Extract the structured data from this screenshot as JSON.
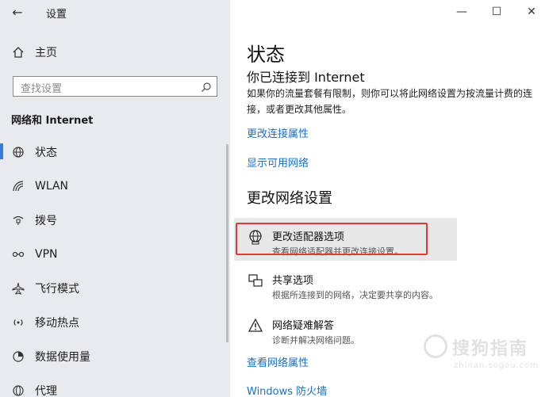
{
  "app": {
    "title": "设置",
    "back_glyph": "←"
  },
  "window": {
    "minimize": "—",
    "maximize": "☐",
    "close": "✕"
  },
  "sidebar": {
    "home_label": "主页",
    "search_placeholder": "查找设置",
    "section_title": "网络和 Internet",
    "items": [
      {
        "label": "状态",
        "icon": "globe-icon",
        "active": true
      },
      {
        "label": "WLAN",
        "icon": "wifi-icon",
        "active": false
      },
      {
        "label": "拨号",
        "icon": "dialup-icon",
        "active": false
      },
      {
        "label": "VPN",
        "icon": "vpn-icon",
        "active": false
      },
      {
        "label": "飞行模式",
        "icon": "airplane-icon",
        "active": false
      },
      {
        "label": "移动热点",
        "icon": "hotspot-icon",
        "active": false
      },
      {
        "label": "数据使用量",
        "icon": "data-usage-icon",
        "active": false
      },
      {
        "label": "代理",
        "icon": "proxy-icon",
        "active": false
      }
    ]
  },
  "main": {
    "title": "状态",
    "connected_text": "你已连接到 Internet",
    "description": "如果你的流量套餐有限制，则你可以将此网络设置为按流量计费的连接，或者更改其他属性。",
    "link_change_props": "更改连接属性",
    "link_show_networks": "显示可用网络",
    "section_change": "更改网络设置",
    "options": [
      {
        "title": "更改适配器选项",
        "sub": "查看网络适配器并更改连接设置。",
        "icon": "adapter-icon"
      },
      {
        "title": "共享选项",
        "sub": "根据所连接到的网络，决定要共享的内容。",
        "icon": "sharing-icon"
      },
      {
        "title": "网络疑难解答",
        "sub": "诊断并解决网络问题。",
        "icon": "troubleshoot-icon"
      }
    ],
    "link_view_props": "查看网络属性",
    "link_firewall": "Windows 防火墙"
  },
  "watermark": {
    "main": "搜狗指南",
    "sub": "zhinan.sogou.com"
  },
  "colors": {
    "accent": "#3a7bd5",
    "link": "#1b6ec2",
    "highlight_border": "#e03a3a"
  }
}
